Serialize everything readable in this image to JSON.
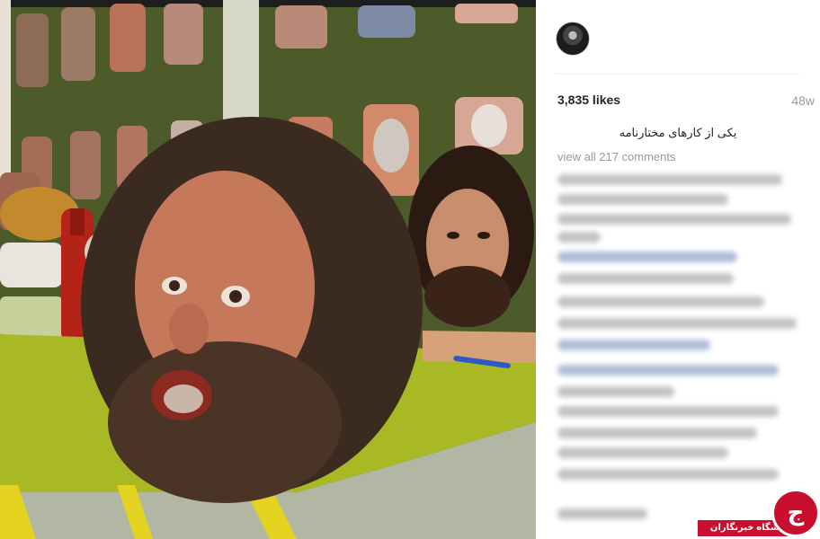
{
  "post": {
    "likes": "3,835 likes",
    "age": "48w",
    "caption": "یکی از کارهای مختارنامه",
    "view_comments": "view all 217 comments"
  },
  "watermark": {
    "text": "باشگاه خبرنگاران",
    "logo_glyph": "ج"
  },
  "photo": {
    "subject": "wax-heads-on-table"
  },
  "colors": {
    "wall": "#4d5a2a",
    "table": "#a9b825",
    "brand_red": "#c8102e",
    "muted": "#9a9a9a"
  }
}
